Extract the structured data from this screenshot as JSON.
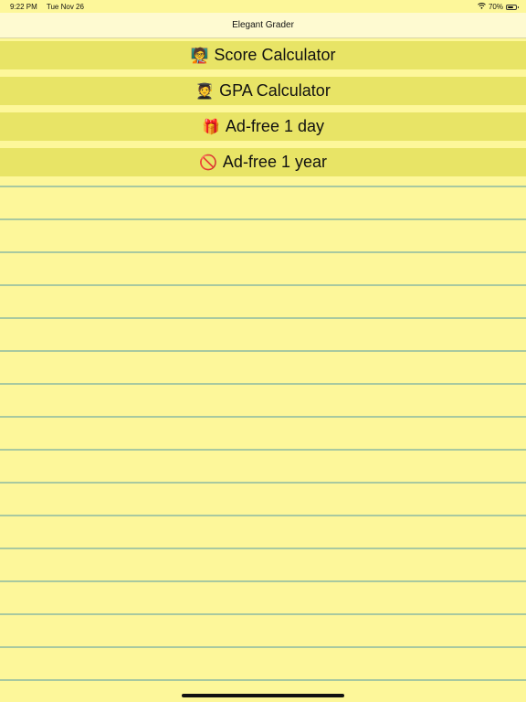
{
  "status_bar": {
    "time": "9:22 PM",
    "date": "Tue Nov 26",
    "battery": "70%",
    "battery_level": 0.7
  },
  "nav": {
    "title": "Elegant Grader"
  },
  "menu": {
    "items": [
      {
        "emoji": "🧑‍🏫",
        "label": "Score Calculator"
      },
      {
        "emoji": "🧑‍🎓",
        "label": "GPA Calculator"
      },
      {
        "emoji": "🎁",
        "label": "Ad-free 1 day"
      },
      {
        "emoji": "🚫",
        "label": "Ad-free 1 year"
      }
    ]
  },
  "colors": {
    "background": "#fdf79a",
    "button": "#e8e466",
    "rule_line": "#a8c9a0",
    "nav_bar": "#fefad1"
  }
}
